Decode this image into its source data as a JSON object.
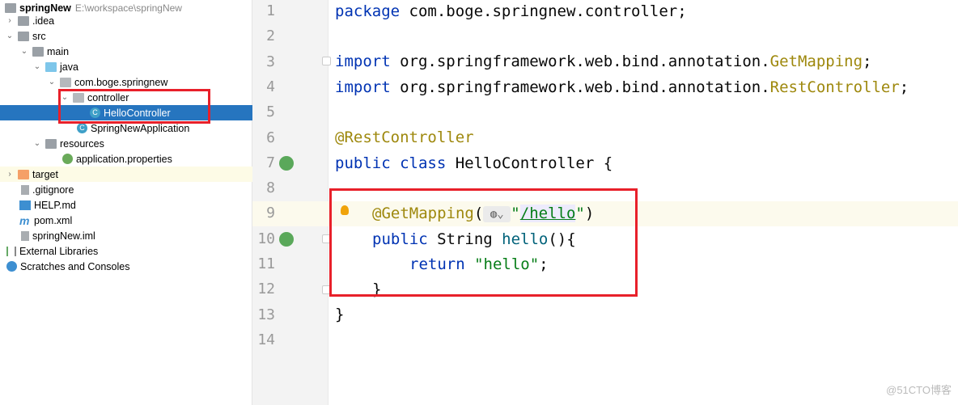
{
  "project": {
    "name": "springNew",
    "path": "E:\\workspace\\springNew"
  },
  "tree": [
    {
      "label": ".idea"
    },
    {
      "label": "src"
    },
    {
      "label": "main"
    },
    {
      "label": "java"
    },
    {
      "label": "com.boge.springnew"
    },
    {
      "label": "controller"
    },
    {
      "label": "HelloController"
    },
    {
      "label": "SpringNewApplication"
    },
    {
      "label": "resources"
    },
    {
      "label": "application.properties"
    },
    {
      "label": "target"
    },
    {
      "label": ".gitignore"
    },
    {
      "label": "HELP.md"
    },
    {
      "label": "pom.xml"
    },
    {
      "label": "springNew.iml"
    },
    {
      "label": "External Libraries"
    },
    {
      "label": "Scratches and Consoles"
    }
  ],
  "editor": {
    "line_numbers": [
      "1",
      "2",
      "3",
      "4",
      "5",
      "6",
      "7",
      "8",
      "9",
      "10",
      "11",
      "12",
      "13",
      "14"
    ],
    "l1": {
      "kw": "package",
      "rest": " com.boge.springnew.controller;"
    },
    "l3": {
      "kw": "import",
      "rest": " org.springframework.web.bind.annotation.",
      "cls": "GetMapping",
      ";": ";"
    },
    "l4": {
      "kw": "import",
      "rest": " org.springframework.web.bind.annotation.",
      "cls": "RestController",
      ";": ";"
    },
    "l6": {
      "ann": "@RestController"
    },
    "l7": {
      "kw": "public class",
      "rest": " HelloController {"
    },
    "l9": {
      "ann": "@GetMapping",
      "open": "(",
      "q1": "\"",
      "path": "/hello",
      "q2": "\"",
      "close": ")"
    },
    "l10": {
      "kw": "public",
      "rest": " String ",
      "fn": "hello",
      "tail": "(){"
    },
    "l11": {
      "kw": "return",
      "str": "\"hello\"",
      "tail": ";"
    },
    "l12": "}",
    "l13": "}"
  },
  "watermark": "@51CTO博客",
  "colors": {
    "selection": "#2675bf",
    "highlight_box": "#e8202a",
    "keyword": "#0033b3",
    "string": "#067d17",
    "annotation": "#9e880d"
  }
}
